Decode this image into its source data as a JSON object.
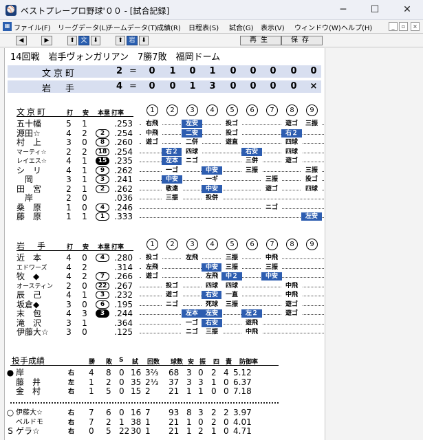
{
  "window": {
    "title": "ベストプレープロ野球'００ - [試合記録]",
    "minimize": "─",
    "maximize": "☐",
    "close": "✕"
  },
  "menu": [
    "ファイル(F)",
    "リーグデータ(L)",
    "チームデータ(T)",
    "成績(R)",
    "日程表(S)",
    "試合(G)",
    "表示(V)",
    "ウィンドウ(W)",
    "ヘルプ(H)"
  ],
  "mdi_buttons": [
    "_",
    "▫",
    "×"
  ],
  "toolbar": {
    "prev": "◀",
    "next": "▶",
    "up1": "⬆",
    "label1": "文",
    "down1": "⬇",
    "up2": "⬆",
    "label2": "岩",
    "down2": "⬇",
    "replay": "再生",
    "save": "保存"
  },
  "game_info": "14回戦　岩手ヴォンガリアン　7勝7敗　福岡ドーム",
  "scoreboard": [
    {
      "team": "文京町",
      "total": "2",
      "eq": "=",
      "innings": [
        "0",
        "1",
        "0",
        "1",
        "0",
        "0",
        "0",
        "0",
        "0"
      ]
    },
    {
      "team": "岩　手",
      "total": "4",
      "eq": "=",
      "innings": [
        "0",
        "0",
        "1",
        "3",
        "0",
        "0",
        "0",
        "0",
        "×"
      ]
    }
  ],
  "batting_header": {
    "bat": "打",
    "hit": "安",
    "hr": "本塁",
    "avg": "打率",
    "innings": [
      "1",
      "2",
      "3",
      "4",
      "5",
      "6",
      "7",
      "8",
      "9"
    ]
  },
  "teams": [
    {
      "name": "文京町",
      "batters": [
        {
          "name": "五十幡",
          "ab": "5",
          "h": "1",
          "hr": "",
          "avg": ".253",
          "res": [
            "右飛",
            "",
            "左安",
            "",
            "投ゴ",
            "",
            "",
            "遊ゴ",
            "三振"
          ]
        },
        {
          "name": "源田☆",
          "ab": "4",
          "h": "2",
          "hr": "2",
          "avg": ".254",
          "res": [
            "中飛",
            "",
            "二安",
            "",
            "投ゴ",
            "",
            "",
            "右２",
            ""
          ]
        },
        {
          "name": "村　上",
          "ab": "3",
          "h": "0",
          "hr": "8",
          "avg": ".260",
          "res": [
            "遊ゴ",
            "",
            "二併",
            "",
            "遊直",
            "",
            "",
            "四球",
            ""
          ]
        },
        {
          "name": "マーティ☆",
          "ab": "2",
          "h": "2",
          "hr": "18",
          "avg": ".254",
          "res": [
            "",
            "右２",
            "四球",
            "",
            "",
            "右安",
            "",
            "四球",
            ""
          ]
        },
        {
          "name": "レイエス☆",
          "ab": "4",
          "h": "1",
          "hr": "15",
          "avg": ".235",
          "res": [
            "",
            "左本",
            "ニゴ",
            "",
            "",
            "三併",
            "",
            "遊ゴ",
            ""
          ]
        },
        {
          "name": "シ　リ",
          "ab": "4",
          "h": "1",
          "hr": "9",
          "avg": ".262",
          "res": [
            "",
            "一ゴ",
            "",
            "中安",
            "",
            "三振",
            "",
            "",
            "三振"
          ]
        },
        {
          "name": "　岡",
          "ab": "3",
          "h": "1",
          "hr": "3",
          "avg": ".241",
          "res": [
            "",
            "中安",
            "",
            "一ギ",
            "",
            "",
            "三振",
            "",
            "投ゴ"
          ]
        },
        {
          "name": "田　宮",
          "ab": "2",
          "h": "1",
          "hr": "2",
          "avg": ".262",
          "res": [
            "",
            "敬遠",
            "",
            "中安",
            "",
            "",
            "遊ゴ",
            "",
            "四球"
          ]
        },
        {
          "name": "　岸",
          "ab": "2",
          "h": "0",
          "hr": "",
          "avg": ".036",
          "res": [
            "",
            "三振",
            "",
            "投併",
            "",
            "",
            "",
            "",
            ""
          ]
        },
        {
          "name": "桑　原",
          "ab": "1",
          "h": "0",
          "hr": "4",
          "avg": ".246",
          "res": [
            "",
            "",
            "",
            "",
            "",
            "",
            "ニゴ",
            "",
            ""
          ]
        },
        {
          "name": "藤　原",
          "ab": "1",
          "h": "1",
          "hr": "1",
          "avg": ".333",
          "res": [
            "",
            "",
            "",
            "",
            "",
            "",
            "",
            "",
            "左安"
          ]
        }
      ]
    },
    {
      "name": "岩　手",
      "batters": [
        {
          "name": "近　本",
          "ab": "4",
          "h": "0",
          "hr": "4",
          "avg": ".280",
          "res": [
            "投ゴ",
            "",
            "左飛",
            "",
            "三振",
            "",
            "中飛",
            "",
            ""
          ]
        },
        {
          "name": "エドワーズ",
          "ab": "4",
          "h": "2",
          "hr": "",
          "avg": ".314",
          "res": [
            "左飛",
            "",
            "",
            "中安",
            "三振",
            "",
            "三振",
            "",
            ""
          ]
        },
        {
          "name": "牧　◆",
          "ab": "4",
          "h": "2",
          "hr": "7",
          "avg": ".266",
          "res": [
            "遊ゴ",
            "",
            "",
            "左飛",
            "中２",
            "",
            "中安",
            "",
            ""
          ]
        },
        {
          "name": "オースティン",
          "ab": "2",
          "h": "0",
          "hr": "22",
          "avg": ".267",
          "res": [
            "",
            "投ゴ",
            "",
            "四球",
            "四球",
            "",
            "",
            "中飛",
            ""
          ]
        },
        {
          "name": "辰　己",
          "ab": "4",
          "h": "1",
          "hr": "3",
          "avg": ".232",
          "res": [
            "",
            "遊ゴ",
            "",
            "右安",
            "一直",
            "",
            "",
            "中飛",
            ""
          ]
        },
        {
          "name": "坂倉◆",
          "ab": "3",
          "h": "0",
          "hr": "6",
          "avg": ".195",
          "res": [
            "",
            "ニゴ",
            "",
            "死球",
            "三振",
            "",
            "",
            "遊ゴ",
            ""
          ]
        },
        {
          "name": "末　包",
          "ab": "4",
          "h": "3",
          "hr": "3",
          "avg": ".244",
          "res": [
            "",
            "",
            "左本",
            "左安",
            "",
            "左２",
            "",
            "遊ゴ",
            ""
          ]
        },
        {
          "name": "滝　沢",
          "ab": "3",
          "h": "1",
          "hr": "",
          "avg": ".364",
          "res": [
            "",
            "",
            "一ゴ",
            "右安",
            "",
            "遊飛",
            "",
            "",
            ""
          ]
        },
        {
          "name": "伊藤大☆",
          "ab": "3",
          "h": "0",
          "hr": "",
          "avg": ".125",
          "res": [
            "",
            "",
            "ニゴ",
            "三振",
            "",
            "中飛",
            "",
            "",
            ""
          ]
        }
      ]
    }
  ],
  "pitching": {
    "title": "投手成績",
    "headers": [
      "勝",
      "敗",
      "S",
      "試",
      "回数",
      "球数",
      "安",
      "振",
      "四",
      "責",
      "防御率"
    ],
    "groups": [
      [
        {
          "mark": "●",
          "name": "岸",
          "hand": "右",
          "w": "4",
          "l": "8",
          "s": "0",
          "g": "16",
          "ip": "3⅔",
          "np": "68",
          "h": "3",
          "so": "0",
          "bb": "2",
          "er": "4",
          "era": "5.12"
        },
        {
          "mark": "",
          "name": "藤　井",
          "hand": "左",
          "w": "1",
          "l": "2",
          "s": "0",
          "g": "35",
          "ip": "2⅓",
          "np": "37",
          "h": "3",
          "so": "3",
          "bb": "1",
          "er": "0",
          "era": "6.37"
        },
        {
          "mark": "",
          "name": "金　村",
          "hand": "右",
          "w": "1",
          "l": "5",
          "s": "0",
          "g": "15",
          "ip": "2",
          "np": "21",
          "h": "1",
          "so": "1",
          "bb": "0",
          "er": "0",
          "era": "7.18"
        }
      ],
      [
        {
          "mark": "○",
          "name": "伊藤大☆",
          "hand": "右",
          "w": "7",
          "l": "6",
          "s": "0",
          "g": "16",
          "ip": "7",
          "np": "93",
          "h": "8",
          "so": "3",
          "bb": "2",
          "er": "2",
          "era": "3.97"
        },
        {
          "mark": "",
          "name": "ベルドモ",
          "hand": "右",
          "w": "7",
          "l": "2",
          "s": "1",
          "g": "38",
          "ip": "1",
          "np": "21",
          "h": "1",
          "so": "0",
          "bb": "2",
          "er": "0",
          "era": "4.01"
        },
        {
          "mark": "S",
          "name": "ゲラ☆",
          "hand": "右",
          "w": "0",
          "l": "5",
          "s": "22",
          "g": "30",
          "ip": "1",
          "np": "21",
          "h": "1",
          "so": "2",
          "bb": "1",
          "er": "0",
          "era": "4.71"
        }
      ]
    ]
  },
  "highlight_color": "#2d5db0",
  "scoreboard_bg": "#d8dff0"
}
